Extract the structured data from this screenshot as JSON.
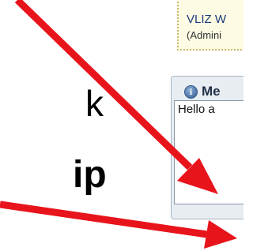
{
  "notice": {
    "title": "VLIZ W",
    "subtitle": "(Admini"
  },
  "overlay_text": {
    "line1": "k",
    "line2": "ip"
  },
  "message_panel": {
    "label": "Me",
    "info_icon": "info-icon",
    "textarea_value": "Hello a"
  },
  "annotations": {
    "arrow_color": "#e8141c",
    "arrow_count": 2
  }
}
